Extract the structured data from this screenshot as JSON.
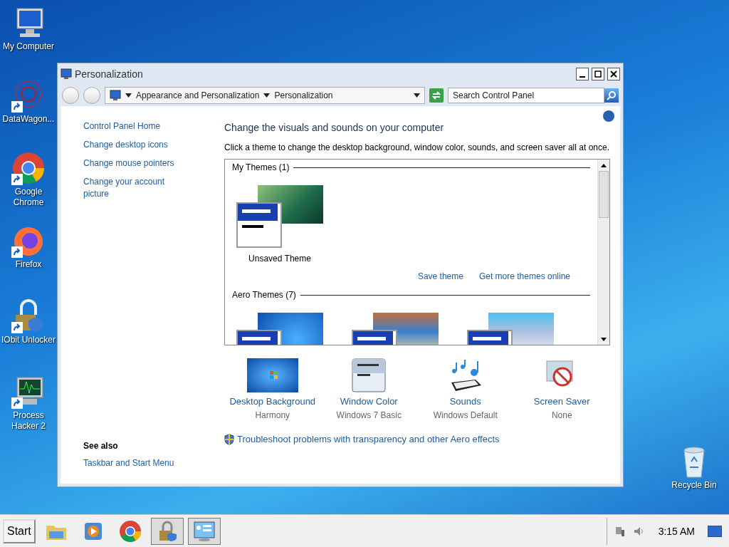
{
  "desktop_icons": [
    {
      "label": "My Computer",
      "kind": "computer",
      "shortcut": false
    },
    {
      "label": "DataWagon...",
      "kind": "network",
      "shortcut": true
    },
    {
      "label": "Google Chrome",
      "kind": "chrome",
      "shortcut": true
    },
    {
      "label": "Firefox",
      "kind": "firefox",
      "shortcut": true
    },
    {
      "label": "IObit Unlocker",
      "kind": "lock",
      "shortcut": true
    },
    {
      "label": "Process Hacker 2",
      "kind": "monitor",
      "shortcut": true
    }
  ],
  "recycle_bin": {
    "label": "Recycle Bin"
  },
  "window": {
    "title": "Personalization",
    "breadcrumb": [
      "Appearance and Personalization",
      "Personalization"
    ],
    "search": {
      "placeholder": "Search Control Panel"
    },
    "sidebar": {
      "links": [
        "Control Panel Home",
        "Change desktop icons",
        "Change mouse pointers",
        "Change your account picture"
      ],
      "see_also": {
        "heading": "See also",
        "links": [
          "Taskbar and Start Menu"
        ]
      }
    },
    "heading": "Change the visuals and sounds on your computer",
    "description": "Click a theme to change the desktop background, window color, sounds, and screen saver all at once.",
    "theme_groups": [
      {
        "title": "My Themes (1)",
        "themes": [
          {
            "label": "Unsaved Theme",
            "kind": "green"
          }
        ],
        "links": [
          "Save theme",
          "Get more themes online"
        ]
      },
      {
        "title": "Aero Themes (7)",
        "themes": [
          {
            "kind": "windows"
          },
          {
            "kind": "photos"
          },
          {
            "kind": "art"
          }
        ]
      }
    ],
    "settings": [
      {
        "kind": "background",
        "label": "Desktop Background",
        "value": "Harmony"
      },
      {
        "kind": "color",
        "label": "Window Color",
        "value": "Windows 7 Basic"
      },
      {
        "kind": "sounds",
        "label": "Sounds",
        "value": "Windows Default"
      },
      {
        "kind": "saver",
        "label": "Screen Saver",
        "value": "None"
      }
    ],
    "troubleshoot": "Troubleshoot problems with transparency and other Aero effects"
  },
  "taskbar": {
    "start": "Start",
    "apps": [
      {
        "kind": "folder",
        "selected": false
      },
      {
        "kind": "media",
        "selected": false
      },
      {
        "kind": "chrome",
        "selected": false
      },
      {
        "kind": "lock",
        "selected": true
      },
      {
        "kind": "panel",
        "selected": true
      }
    ],
    "time": "3:15 AM"
  }
}
